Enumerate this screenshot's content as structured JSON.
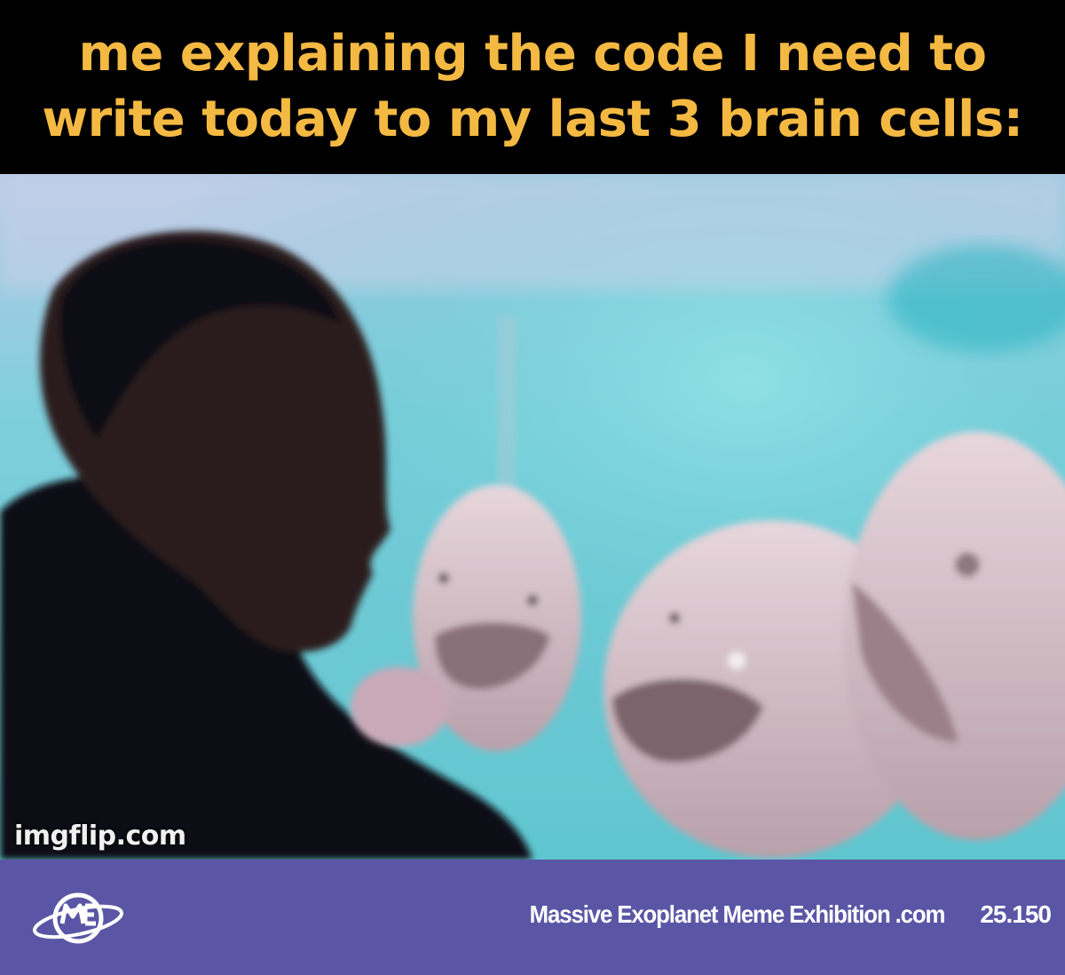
{
  "caption": {
    "line1": "me explaining the code I need to",
    "line2": "write today to my last 3 brain cells:"
  },
  "photo": {
    "watermark": "imgflip.com"
  },
  "footer": {
    "logo_icon": "planet-ring-logo-icon",
    "site_name": "Massive Exoplanet Meme Exhibition .com",
    "number": "25.150"
  },
  "colors": {
    "caption_text": "#f4b942",
    "caption_bg": "#000000",
    "footer_bg": "#5a56a5",
    "water": "#5fc6cf"
  }
}
